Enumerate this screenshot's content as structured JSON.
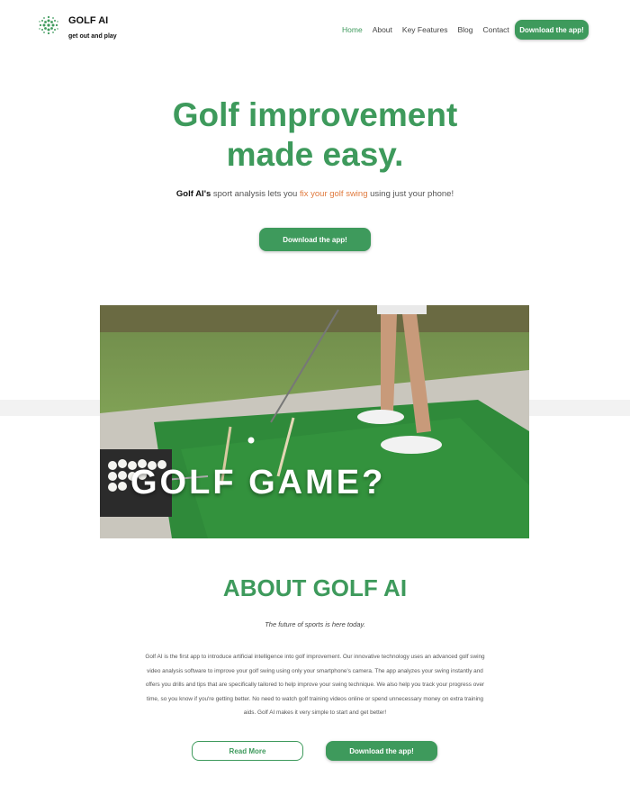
{
  "brand": {
    "name": "GOLF AI",
    "tagline": "get out and play"
  },
  "nav": {
    "items": [
      "Home",
      "About",
      "Key Features",
      "Blog",
      "Contact"
    ],
    "active": "Home",
    "cta": "Download the app!"
  },
  "hero": {
    "title_line1": "Golf improvement",
    "title_line2": "made easy.",
    "sub_brand": "Golf AI's",
    "sub_mid": " sport analysis lets you ",
    "sub_highlight": "fix your golf swing",
    "sub_end": " using just your phone!",
    "cta": "Download the app!"
  },
  "video": {
    "caption": "GOLF GAME?"
  },
  "about": {
    "title": "ABOUT GOLF AI",
    "subtitle": "The future of sports is here today.",
    "body": "Golf AI is the first app to introduce artificial intelligence into golf improvement. Our innovative technology uses an advanced golf swing video analysis software to improve your golf swing using only your smartphone's camera. The app analyzes your swing instantly and offers you drills and tips that are specifically tailored to help improve your swing technique. We also help you track your progress over time, so you know if you're getting better. No need to watch golf training videos online or spend unnecessary money on extra training aids. Golf AI makes it very simple to start and get better!",
    "read_more": "Read More",
    "cta": "Download the app!"
  },
  "colors": {
    "brand_green": "#3e9a5c",
    "highlight_orange": "#e07a3e"
  }
}
